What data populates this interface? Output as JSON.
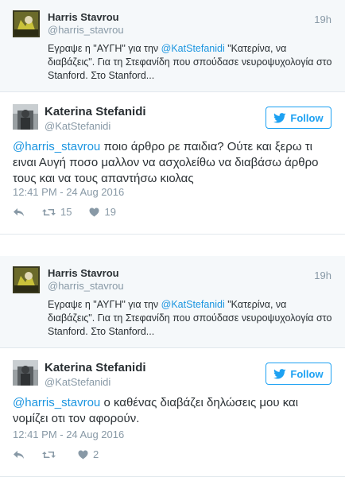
{
  "threads": [
    {
      "reply": {
        "name": "Harris Stavrou",
        "handle": "@harris_stavrou",
        "time": "19h",
        "text_prefix": "Εγραψε η \"ΑΥΓΗ\" για την ",
        "mention": "@KatStefanidi",
        "text_suffix": " \"Κατερίνα, να διαβάζεις\". Για τη Στεφανίδη που σπούδασε νευροψυχολογία στο Stanford. Στο Stanford..."
      },
      "main": {
        "name": "Katerina Stefanidi",
        "handle": "@KatStefanidi",
        "follow_label": "Follow",
        "mention": "@harris_stavrou",
        "text": " ποιο άρθρο ρε παιδια? Ούτε και ξερω τι ειναι Αυγή ποσο μαλλον να ασχολείθω να διαβάσω άρθρο τους και να τους απαντήσω κιολας",
        "date": "12:41 PM - 24 Aug 2016",
        "retweets": "15",
        "likes": "19"
      }
    },
    {
      "reply": {
        "name": "Harris Stavrou",
        "handle": "@harris_stavrou",
        "time": "19h",
        "text_prefix": "Εγραψε η \"ΑΥΓΗ\" για την ",
        "mention": "@KatStefanidi",
        "text_suffix": " \"Κατερίνα, να διαβάζεις\". Για τη Στεφανίδη που σπούδασε νευροψυχολογία στο Stanford. Στο Stanford..."
      },
      "main": {
        "name": "Katerina Stefanidi",
        "handle": "@KatStefanidi",
        "follow_label": "Follow",
        "mention": "@harris_stavrou",
        "text": " ο καθένας διαβάζει δηλώσεις μου και νομίζει οτι τον αφορούν.",
        "date": "12:41 PM - 24 Aug 2016",
        "retweets": "",
        "likes": "2"
      }
    }
  ],
  "colors": {
    "accent": "#1da1f2",
    "link": "#1b95e0",
    "muted": "#8899a6",
    "reply_bg": "#f5f8fa"
  }
}
